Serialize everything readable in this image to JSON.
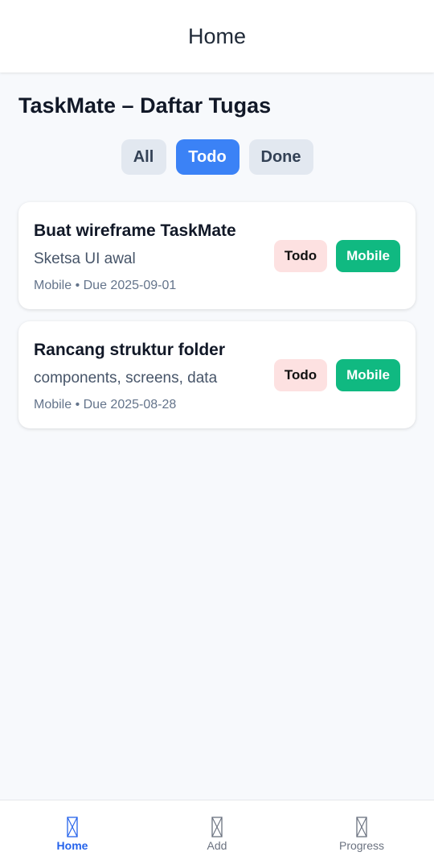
{
  "header": {
    "title": "Home"
  },
  "page_title": "TaskMate – Daftar Tugas",
  "filters": [
    {
      "label": "All",
      "active": false
    },
    {
      "label": "Todo",
      "active": true
    },
    {
      "label": "Done",
      "active": false
    }
  ],
  "tasks": [
    {
      "title": "Buat wireframe TaskMate",
      "description": "Sketsa UI awal",
      "meta": "Mobile • Due 2025-09-01",
      "status": "Todo",
      "category": "Mobile"
    },
    {
      "title": "Rancang struktur folder",
      "description": "components, screens, data",
      "meta": "Mobile • Due 2025-08-28",
      "status": "Todo",
      "category": "Mobile"
    }
  ],
  "bottom_nav": [
    {
      "label": "Home",
      "icon": "placeholder-icon",
      "active": true
    },
    {
      "label": "Add",
      "icon": "placeholder-icon",
      "active": false
    },
    {
      "label": "Progress",
      "icon": "placeholder-icon",
      "active": false
    }
  ],
  "colors": {
    "primary": "#3b82f6",
    "nav_active": "#2563eb",
    "status_todo_bg": "#fde1e1",
    "category_mobile_bg": "#10b981",
    "background": "#f7f9fc"
  }
}
